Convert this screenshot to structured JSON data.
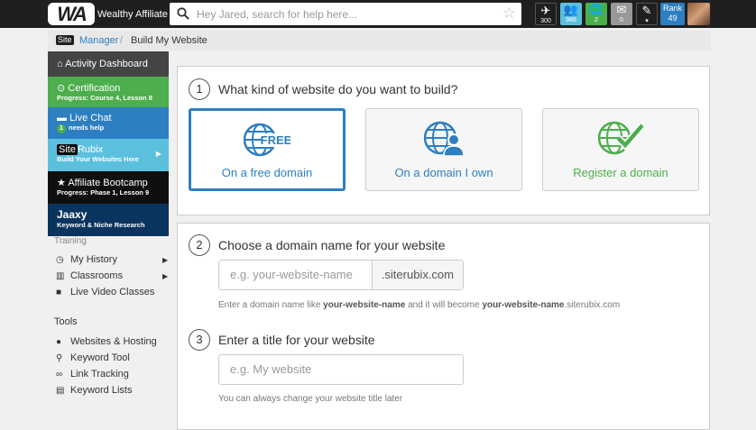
{
  "topbar": {
    "logo_mark": "WA",
    "logo_text": "Wealthy Affiliate",
    "search_placeholder": "Hey Jared, search for help here...",
    "icons": [
      {
        "name": "plane-icon",
        "count": "300",
        "color": "#1f1f1f"
      },
      {
        "name": "users-icon",
        "count": "986",
        "color": "#5bc0de"
      },
      {
        "name": "globe-icon",
        "count": "2",
        "color": "#4cae4c"
      },
      {
        "name": "mail-icon",
        "count": "0",
        "color": "#999999"
      },
      {
        "name": "pen-icon",
        "count": "",
        "color": "#1f1f1f"
      }
    ],
    "rank_label": "Rank",
    "rank_value": "49"
  },
  "breadcrumb": {
    "site_badge": "Site",
    "link": "Manager",
    "separator": "/",
    "current": "Build My Website"
  },
  "sidebar": {
    "dashboard": "Activity Dashboard",
    "certification": {
      "title": "Certification",
      "progress": "Progress: Course 4, Lesson 8"
    },
    "live_chat": {
      "title": "Live Chat",
      "badge": "1",
      "sub": "needs help"
    },
    "siterubix": {
      "badge": "Site",
      "title": "Rubix",
      "sub": "Build Your Websites Here"
    },
    "bootcamp": {
      "title": "Affiliate Bootcamp",
      "progress": "Progress: Phase 1, Lesson 9"
    },
    "jaaxy": {
      "title": "Jaaxy",
      "sub": "Keyword & Niche Research"
    },
    "training_label": "Training",
    "training": [
      "My History",
      "Classrooms",
      "Live Video Classes"
    ],
    "tools_label": "Tools",
    "tools": [
      "Websites & Hosting",
      "Keyword Tool",
      "Link Tracking",
      "Keyword Lists"
    ]
  },
  "step1": {
    "number": "1",
    "question": "What kind of website do you want to build?",
    "options": [
      {
        "label": "On a free domain",
        "icon_text": "FREE",
        "color": "#2d7fc1",
        "selected": true
      },
      {
        "label": "On a domain I own",
        "color": "#2d7fc1",
        "selected": false
      },
      {
        "label": "Register a domain",
        "color": "#4cae4c",
        "selected": false
      }
    ]
  },
  "step2": {
    "number": "2",
    "question": "Choose a domain name for your website",
    "placeholder": "e.g. your-website-name",
    "suffix": ".siterubix.com",
    "help_prefix": "Enter a domain name like ",
    "help_bold1": "your-website-name",
    "help_mid": " and it will become ",
    "help_bold2": "your-website-name",
    "help_suffix": ".siterubix.com"
  },
  "step3": {
    "number": "3",
    "question": "Enter a title for your website",
    "placeholder": "e.g. My website",
    "help": "You can always change your website title later"
  }
}
